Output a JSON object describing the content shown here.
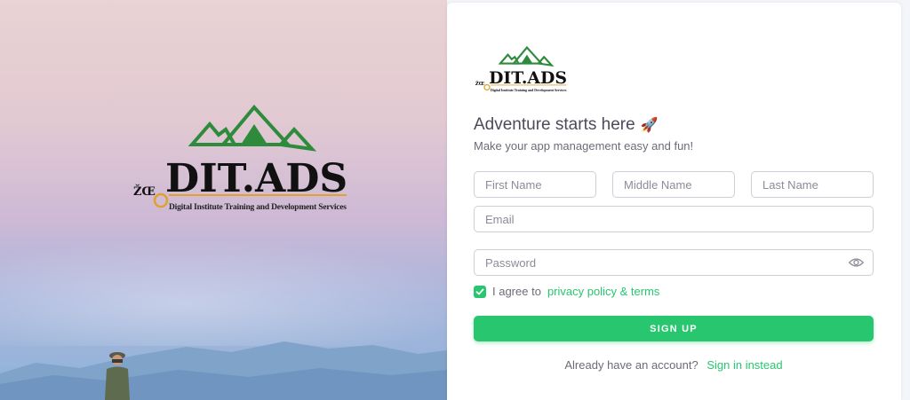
{
  "brand": {
    "prefix": "ŽŒ",
    "name": "DIT.ADS",
    "tagline": "Digital Institute Training and Development Services",
    "mountain_color": "#2e8b3c",
    "accent_color": "#e0a22a"
  },
  "form": {
    "title": "Adventure starts here",
    "title_emoji": "🚀",
    "subtitle": "Make your app management easy and fun!",
    "first_name_placeholder": "First Name",
    "middle_name_placeholder": "Middle Name",
    "last_name_placeholder": "Last Name",
    "email_placeholder": "Email",
    "password_placeholder": "Password",
    "agree_text": "I agree to",
    "agree_link": "privacy policy & terms",
    "agree_checked": true,
    "submit_label": "SIGN UP",
    "signin_prompt": "Already have an account?",
    "signin_link": "Sign in instead"
  },
  "colors": {
    "primary": "#28c76f",
    "text": "#6d6b77"
  }
}
